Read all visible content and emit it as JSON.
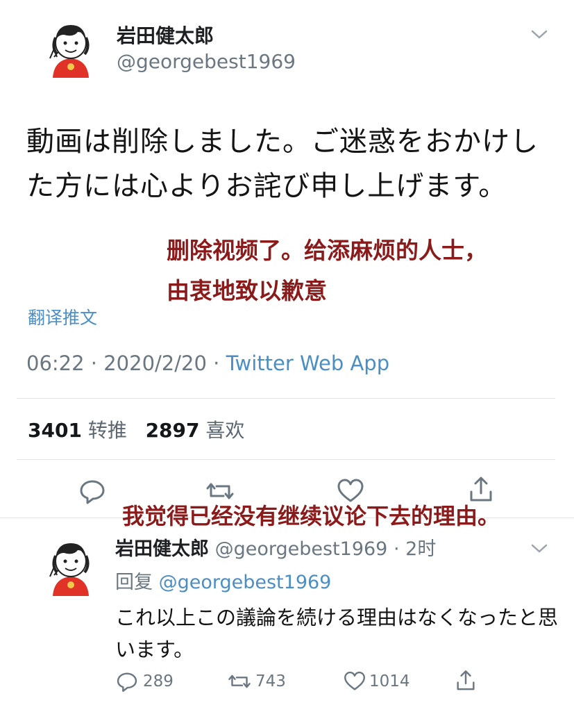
{
  "tweet": {
    "display_name": "岩田健太郎",
    "handle": "@georgebest1969",
    "text": "動画は削除しました。ご迷惑をおかけした方には心よりお詫び申し上げます。",
    "annotation_line1": "删除视频了。给添麻烦的人士，",
    "annotation_line2": "由衷地致以歉意",
    "translate_label": "翻译推文",
    "time": "06:22",
    "date": "2020/2/20",
    "separator": "·",
    "source": "Twitter Web App",
    "retweet_count": "3401",
    "retweet_label": "转推",
    "like_count": "2897",
    "like_label": "喜欢"
  },
  "annotation_overlay": "我觉得已经没有继续议论下去的理由。",
  "reply": {
    "display_name": "岩田健太郎",
    "handle": "@georgebest1969",
    "separator": "·",
    "age": "2时",
    "replying_prefix": "回复",
    "replying_to": "@georgebest1969",
    "text": "これ以上この議論を続ける理由はなくなったと思います。",
    "counts": {
      "reply": "289",
      "retweet": "743",
      "like": "1014"
    }
  },
  "icons": {
    "avatar": "cartoon-avatar-icon",
    "menu": "chevron-down-icon",
    "reply": "reply-icon",
    "retweet": "retweet-icon",
    "like": "heart-icon",
    "share": "share-icon"
  },
  "colors": {
    "link": "#4b8ec4",
    "secondary_text": "#6b7780",
    "annotation": "#8b1a1a",
    "avatar_dress": "#e03226"
  }
}
